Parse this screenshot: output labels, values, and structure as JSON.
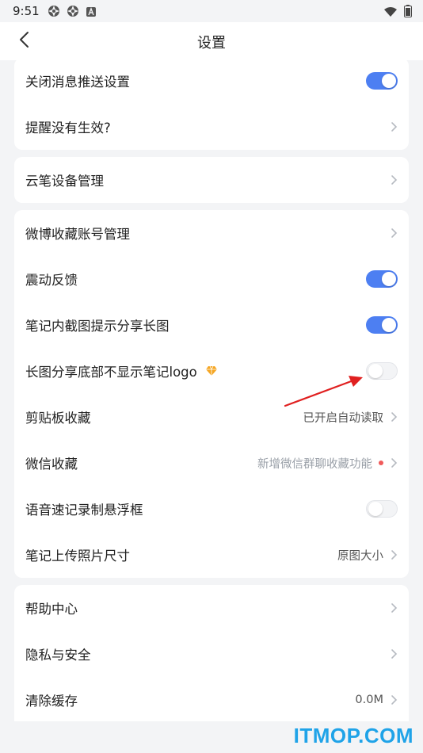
{
  "status_bar": {
    "time": "9:51",
    "icons": [
      "aperture-icon",
      "aperture-icon",
      "a-badge-icon",
      "wifi-icon",
      "battery-icon"
    ]
  },
  "header": {
    "title": "设置",
    "back_icon": "chevron-left-icon"
  },
  "groups": [
    {
      "rows": [
        {
          "label": "关闭消息推送设置",
          "control": "toggle",
          "state": "on"
        },
        {
          "label": "提醒没有生效?",
          "control": "chevron"
        }
      ]
    },
    {
      "rows": [
        {
          "label": "云笔设备管理",
          "control": "chevron"
        }
      ]
    },
    {
      "rows": [
        {
          "label": "微博收藏账号管理",
          "control": "chevron"
        },
        {
          "label": "震动反馈",
          "control": "toggle",
          "state": "on"
        },
        {
          "label": "笔记内截图提示分享长图",
          "control": "toggle",
          "state": "on"
        },
        {
          "label": "长图分享底部不显示笔记logo",
          "control": "toggle",
          "state": "off",
          "badge": "diamond-icon"
        },
        {
          "label": "剪贴板收藏",
          "control": "chevron",
          "value": "已开启自动读取"
        },
        {
          "label": "微信收藏",
          "control": "chevron",
          "value": "新增微信群聊收藏功能",
          "dot": true
        },
        {
          "label": "语音速记录制悬浮框",
          "control": "toggle",
          "state": "off"
        },
        {
          "label": "笔记上传照片尺寸",
          "control": "chevron",
          "value": "原图大小"
        }
      ]
    },
    {
      "rows": [
        {
          "label": "帮助中心",
          "control": "chevron"
        },
        {
          "label": "隐私与安全",
          "control": "chevron"
        },
        {
          "label": "清除缓存",
          "control": "chevron",
          "value": "0.0M"
        }
      ]
    }
  ],
  "watermark": "ITMOP.COM",
  "colors": {
    "accent": "#4d7ff2",
    "background": "#f3f4f6",
    "card": "#ffffff",
    "annotation": "#e02020",
    "watermark": "#1fa3e8",
    "dot": "#f05a5a",
    "badge": "#f5a623"
  }
}
